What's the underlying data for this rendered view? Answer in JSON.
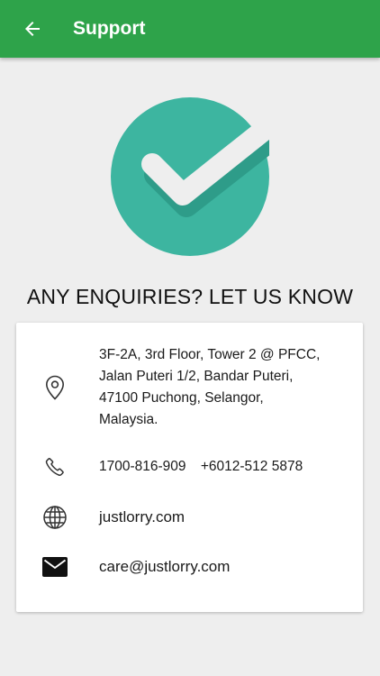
{
  "appbar": {
    "title": "Support",
    "back_icon": "arrow-left-icon",
    "color": "#2ea34a"
  },
  "hero": {
    "icon": "check-circle-icon",
    "circle_color": "#3db5a0"
  },
  "headline": "ANY ENQUIRIES? LET US KNOW",
  "contact": {
    "address": {
      "icon": "location-pin-icon",
      "lines": [
        "3F-2A, 3rd Floor, Tower 2 @ PFCC,",
        "Jalan Puteri 1/2, Bandar Puteri,",
        "47100 Puchong, Selangor,",
        "Malaysia."
      ]
    },
    "phone": {
      "icon": "phone-icon",
      "numbers": [
        "1700-816-909",
        "+6012-512 5878"
      ]
    },
    "website": {
      "icon": "globe-icon",
      "value": "justlorry.com"
    },
    "email": {
      "icon": "mail-icon",
      "value": "care@justlorry.com"
    }
  }
}
